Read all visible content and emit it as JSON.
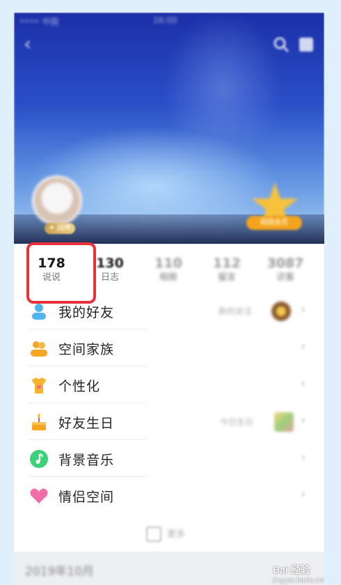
{
  "status_bar": {
    "carrier": "•••• 中国",
    "time": "16:00"
  },
  "cover": {
    "level_badge": "✦ 战神",
    "vip_label": "超级会员"
  },
  "stats": [
    {
      "value": "178",
      "label": "说说"
    },
    {
      "value": "130",
      "label": "日志"
    },
    {
      "value": "110",
      "label": "相册"
    },
    {
      "value": "112",
      "label": "留言"
    },
    {
      "value": "3087",
      "label": "访客"
    }
  ],
  "menu": {
    "items": [
      {
        "label": "我的好友",
        "right_text": "新的关注"
      },
      {
        "label": "空间家族"
      },
      {
        "label": "个性化"
      },
      {
        "label": "好友生日",
        "right_text": "今日生日"
      },
      {
        "label": "背景音乐"
      },
      {
        "label": "情侣空间"
      }
    ],
    "more_label": "更多"
  },
  "timeline": {
    "date": "2019年10月"
  },
  "watermark": {
    "brand": "Bai 经验",
    "url": "jingyan.baidu.com"
  },
  "colors": {
    "highlight": "#e8313a",
    "accent_orange": "#f4a51b"
  }
}
